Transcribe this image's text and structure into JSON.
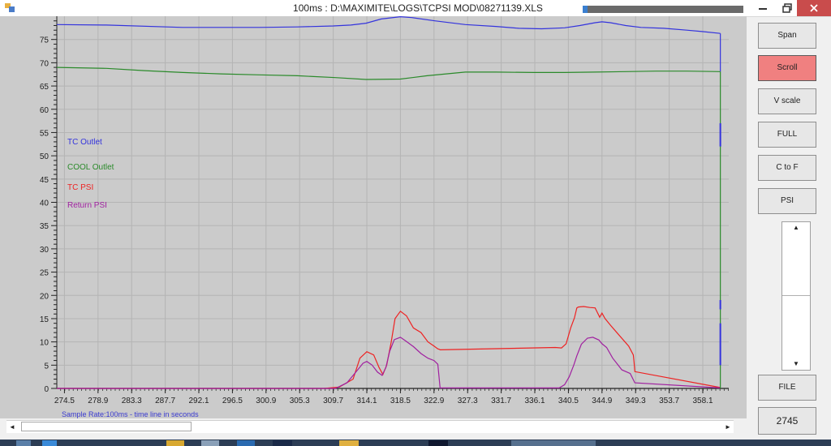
{
  "window": {
    "title": "100ms : D:\\MAXIMITE\\LOGS\\TCPSI MOD\\08271139.XLS",
    "minimize_icon": "minimize-icon",
    "maximize_icon": "restore-icon",
    "close_icon": "close-icon",
    "progress": 0.03,
    "progress_color": "#3a7fd0"
  },
  "side_buttons": [
    {
      "name": "span-button",
      "label": "Span",
      "active": false
    },
    {
      "name": "scroll-button",
      "label": "Scroll",
      "active": true
    },
    {
      "name": "vscale-button",
      "label": "V scale",
      "active": false
    },
    {
      "name": "full-button",
      "label": "FULL",
      "active": false
    },
    {
      "name": "c-to-f-button",
      "label": "C to F",
      "active": false
    },
    {
      "name": "psi-button",
      "label": "PSI",
      "active": false
    }
  ],
  "file_button": {
    "label": "FILE"
  },
  "counter": {
    "value": "2745"
  },
  "scroll_arrows": {
    "up": "▲",
    "down": "▼",
    "left": "◄",
    "right": "►"
  },
  "colors": {
    "tc_outlet": "#3333dd",
    "cool_outlet": "#2a8a2a",
    "tc_psi": "#ee2222",
    "return_psi": "#a020a0",
    "active_button": "#f08080",
    "plot_bg": "#cbcbcb"
  },
  "chart_data": {
    "type": "line",
    "ylim": [
      0,
      80
    ],
    "xlim": [
      273.5,
      361.5
    ],
    "yticks": [
      0,
      5,
      10,
      15,
      20,
      25,
      30,
      35,
      40,
      45,
      50,
      55,
      60,
      65,
      70,
      75
    ],
    "xticks": [
      "274.5",
      "278.9",
      "283.3",
      "287.7",
      "292.1",
      "296.5",
      "300.9",
      "305.3",
      "309.7",
      "314.1",
      "318.5",
      "322.9",
      "327.3",
      "331.7",
      "336.1",
      "340.5",
      "344.9",
      "349.3",
      "353.7",
      "358.1"
    ],
    "grid": true,
    "footnote": "Sample Rate:100ms - time line in seconds",
    "legend_position": "left",
    "series": [
      {
        "name": "TC Outlet",
        "color_key": "tc_outlet",
        "x": [
          273.5,
          280,
          290,
          300,
          305,
          309.7,
          312,
          314,
          316,
          318.5,
          320,
          323,
          327,
          331,
          334,
          337,
          340,
          342,
          344,
          344.9,
          346,
          348,
          350,
          353,
          356,
          358,
          360.4
        ],
        "y": [
          78.2,
          78.1,
          77.6,
          77.6,
          77.7,
          77.9,
          78.1,
          78.5,
          79.4,
          79.9,
          79.7,
          79.0,
          78.2,
          77.8,
          77.4,
          77.3,
          77.5,
          78.0,
          78.6,
          78.8,
          78.6,
          78.0,
          77.6,
          77.4,
          77.0,
          76.7,
          76.3
        ]
      },
      {
        "name": "COOL Outlet",
        "color_key": "cool_outlet",
        "x": [
          273.5,
          280,
          285,
          290,
          295,
          300,
          305,
          310,
          314,
          318.5,
          322,
          327,
          331,
          336,
          340,
          344,
          348,
          352,
          356,
          360.4
        ],
        "y": [
          69.0,
          68.8,
          68.3,
          67.9,
          67.6,
          67.4,
          67.2,
          66.8,
          66.4,
          66.5,
          67.2,
          68.0,
          68.0,
          67.9,
          67.9,
          68.0,
          68.1,
          68.2,
          68.2,
          68.1
        ]
      },
      {
        "name": "TC PSI",
        "color_key": "tc_psi",
        "x": [
          273.5,
          308.5,
          310.5,
          312.3,
          313.2,
          314.1,
          315.0,
          315.7,
          316.2,
          316.7,
          317.3,
          317.8,
          318.5,
          319.3,
          320.2,
          321.2,
          322.1,
          322.9,
          323.4,
          323.6,
          323.7,
          338.8,
          339.6,
          340.2,
          340.8,
          341.3,
          341.6,
          341.8,
          342.5,
          343.3,
          344.0,
          344.6,
          344.9,
          345.3,
          346.0,
          346.9,
          348.4,
          349.0,
          349.1,
          349.2,
          360.4
        ],
        "y": [
          0,
          0,
          0.3,
          2.0,
          6.5,
          7.9,
          7.2,
          4.5,
          3.0,
          5.0,
          10.0,
          15.0,
          16.6,
          15.6,
          13.0,
          12.0,
          10.0,
          9.1,
          8.5,
          8.4,
          8.3,
          8.8,
          8.7,
          9.6,
          13.0,
          15.2,
          17.3,
          17.5,
          17.6,
          17.4,
          17.3,
          15.3,
          16.2,
          15.0,
          13.6,
          11.9,
          9.1,
          7.2,
          5.7,
          3.6,
          0.2
        ]
      },
      {
        "name": "Return PSI",
        "color_key": "return_psi",
        "x": [
          273.5,
          310.0,
          311.5,
          312.8,
          313.6,
          314.1,
          314.8,
          315.5,
          316.1,
          316.6,
          317.1,
          317.7,
          318.5,
          319.2,
          320.2,
          321.2,
          322.1,
          322.9,
          323.4,
          323.7,
          339.3,
          340.0,
          340.6,
          341.2,
          341.6,
          342.2,
          343.0,
          343.7,
          344.5,
          344.9,
          345.5,
          346.3,
          347.5,
          348.6,
          349.2,
          360.4
        ],
        "y": [
          0,
          0,
          1.2,
          3.8,
          5.4,
          5.8,
          5.0,
          3.5,
          2.8,
          4.5,
          8.0,
          10.5,
          11.0,
          10.2,
          9.0,
          7.5,
          6.5,
          6.0,
          5.2,
          0.1,
          0.1,
          0.8,
          2.5,
          5.0,
          7.0,
          9.5,
          10.8,
          11.0,
          10.4,
          9.6,
          8.8,
          6.5,
          4.0,
          3.2,
          1.2,
          0.1
        ]
      }
    ]
  }
}
